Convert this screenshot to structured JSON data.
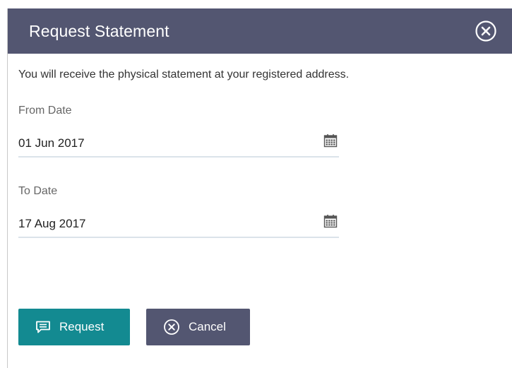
{
  "dialog": {
    "title": "Request Statement",
    "info_text": "You will receive the physical statement at your registered address."
  },
  "from_date": {
    "label": "From Date",
    "value": "01 Jun 2017"
  },
  "to_date": {
    "label": "To Date",
    "value": "17 Aug 2017"
  },
  "actions": {
    "request_label": "Request",
    "cancel_label": "Cancel"
  },
  "icons": {
    "close": "close-circle-icon",
    "calendar": "calendar-icon",
    "request": "message-icon",
    "cancel": "cancel-circle-icon"
  },
  "colors": {
    "header": "#535671",
    "request_button": "#138a91",
    "cancel_button": "#535671",
    "field_underline": "#dbe3ea"
  }
}
